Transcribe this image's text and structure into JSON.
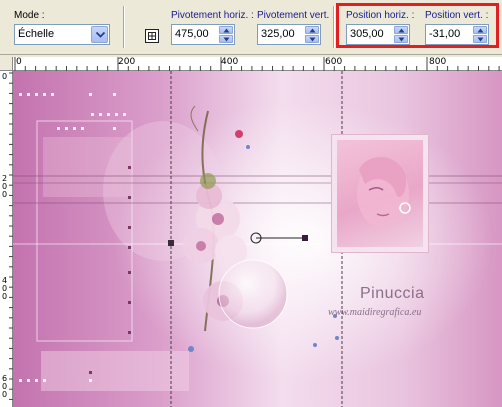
{
  "toolbar": {
    "mode_label": "Mode :",
    "mode_value": "Échelle",
    "pivot_h_label": "Pivotement horiz. :",
    "pivot_h_value": "475,00",
    "pivot_v_label": "Pivotement vert. :",
    "pivot_v_value": "325,00",
    "pos_h_label": "Position horiz. :",
    "pos_h_value": "305,00",
    "pos_v_label": "Position vert. :",
    "pos_v_value": "-31,00"
  },
  "ruler": {
    "top_labels": [
      "0",
      "200",
      "400",
      "600",
      "800"
    ],
    "left_labels": [
      "0",
      "2\n0\n0",
      "4\n0\n0",
      "6\n0\n0"
    ]
  },
  "watermark": {
    "name": "Pinuccia",
    "url": "www.maidiregrafica.eu"
  },
  "colors": {
    "highlight": "#e02020",
    "canvas_accent": "#c06caa"
  },
  "icons": {
    "dropdown": "chevron-down-icon",
    "spinner": "up-down-arrows-icon",
    "pivot": "pivot-target-icon"
  }
}
